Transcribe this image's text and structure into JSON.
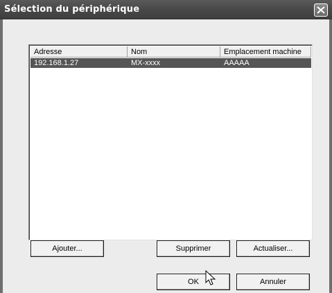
{
  "window": {
    "title": "Sélection du périphérique"
  },
  "list": {
    "columns": [
      "Adresse",
      "Nom",
      "Emplacement machine"
    ],
    "rows": [
      {
        "address": "192.168.1.27",
        "name": "MX-xxxx",
        "location": "AAAAA",
        "selected": true
      }
    ]
  },
  "buttons": {
    "add": "Ajouter...",
    "delete": "Supprimer",
    "refresh": "Actualiser...",
    "ok": "OK",
    "cancel": "Annuler"
  },
  "icons": {
    "close": "close-icon",
    "cursor": "mouse-pointer-icon"
  }
}
